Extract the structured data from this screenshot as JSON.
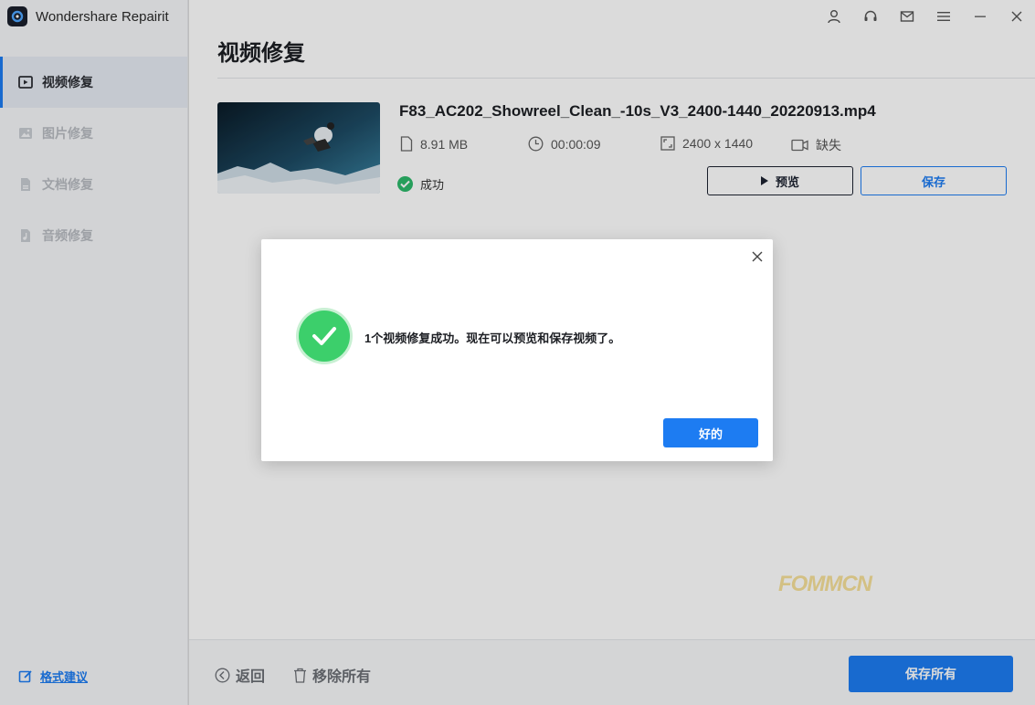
{
  "app": {
    "title": "Wondershare Repairit"
  },
  "sidebar": {
    "items": [
      {
        "label": "视频修复",
        "icon": "video-icon"
      },
      {
        "label": "图片修复",
        "icon": "image-icon"
      },
      {
        "label": "文档修复",
        "icon": "document-icon"
      },
      {
        "label": "音频修复",
        "icon": "music-icon"
      }
    ],
    "feedback": {
      "label": "格式建议",
      "icon": "edit-icon"
    }
  },
  "topbar": {
    "icons": [
      "user-icon",
      "headset-icon",
      "mail-icon",
      "menu-icon",
      "minimize-icon",
      "close-icon"
    ]
  },
  "main": {
    "title": "视频修复",
    "file": {
      "name": "F83_AC202_Showreel_Clean_-10s_V3_2400-1440_20220913.mp4",
      "size": "8.91  MB",
      "duration": "00:00:09",
      "resolution": "2400 x 1440",
      "camera": "缺失",
      "status": "成功",
      "preview_label": "预览",
      "save_label": "保存"
    }
  },
  "bottom": {
    "back_label": "返回",
    "remove_all_label": "移除所有",
    "save_all_label": "保存所有"
  },
  "watermark": "FOMMCN",
  "dialog": {
    "message": "1个视频修复成功。现在可以预览和保存视频了。",
    "ok_label": "好的"
  },
  "colors": {
    "accent": "#1d7cf2",
    "success": "#3ccf6b",
    "sidebar_bg": "#f5f6f8"
  }
}
